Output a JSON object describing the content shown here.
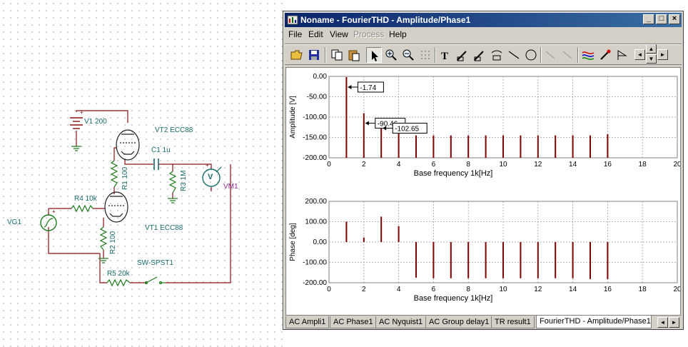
{
  "schematic": {
    "labels": {
      "v1": "V1 200",
      "vt2": "VT2 ECC88",
      "c1": "C1 1u",
      "r1": "R1 100",
      "r3": "R3 1M",
      "vm1": "VM1",
      "vm1_symbol": "V",
      "r4": "R4 10k",
      "vg1": "VG1",
      "vt1": "VT1 ECC88",
      "r2": "R2 100",
      "sw": "SW-SPST1",
      "r5": "R5 20k"
    }
  },
  "window": {
    "title": "Noname - FourierTHD - Amplitude/Phase1",
    "buttons": {
      "minimize": "_",
      "maximize": "□",
      "close": "×"
    },
    "menu": [
      "File",
      "Edit",
      "View",
      "Process",
      "Help"
    ],
    "menu_disabled": "Process",
    "toolbar": {
      "open": "open-folder-icon",
      "save": "save-icon",
      "copy": "copy-icon",
      "paste": "paste-icon",
      "select": "pointer-icon",
      "zoom_in": "zoom-in-icon",
      "zoom_fit": "zoom-100-icon",
      "text": "T",
      "scroll_left": "◄",
      "scroll_right": "►"
    },
    "tabs": [
      "AC Ampli1",
      "AC Phase1",
      "AC Nyquist1",
      "AC Group delay1",
      "TR result1",
      "FourierTHD - Amplitude/Phase1"
    ]
  },
  "chart_data": [
    {
      "type": "bar",
      "title": "",
      "xlabel": "Base frequency 1k[Hz]",
      "ylabel": "Amplitude [V]",
      "xlim": [
        0,
        20
      ],
      "ylim": [
        -200,
        0
      ],
      "xticks": [
        0,
        2,
        4,
        6,
        8,
        10,
        12,
        14,
        16,
        18,
        20
      ],
      "ytick_labels": [
        "0.00",
        "-50.00",
        "-100.00",
        "-150.00",
        "-200.00"
      ],
      "yticks": [
        0,
        -50,
        -100,
        -150,
        -200
      ],
      "x": [
        1,
        2,
        3,
        4,
        5,
        6,
        7,
        8,
        9,
        10,
        11,
        12,
        13,
        14,
        15,
        16
      ],
      "values": [
        -1.74,
        -90.46,
        -102.65,
        -140,
        -145,
        -145,
        -145,
        -145,
        -145,
        -145,
        -145,
        -145,
        -145,
        -145,
        -145,
        -142
      ],
      "annotations": [
        {
          "x": 1,
          "y": -1.74,
          "text": "-1.74"
        },
        {
          "x": 2,
          "y": -90.46,
          "text": "-90.46"
        },
        {
          "x": 3,
          "y": -102.65,
          "text": "-102.65"
        }
      ],
      "grid": true,
      "color": "#800000"
    },
    {
      "type": "bar",
      "title": "",
      "xlabel": "Base frequency 1k[Hz]",
      "ylabel": "Phase [deg]",
      "xlim": [
        0,
        20
      ],
      "ylim": [
        -200,
        200
      ],
      "xticks": [
        0,
        2,
        4,
        6,
        8,
        10,
        12,
        14,
        16,
        18,
        20
      ],
      "ytick_labels": [
        "200.00",
        "100.00",
        "0.00",
        "-100.00",
        "-200.00"
      ],
      "yticks": [
        200,
        100,
        0,
        -100,
        -200
      ],
      "x": [
        1,
        2,
        3,
        4,
        5,
        6,
        7,
        8,
        9,
        10,
        11,
        12,
        13,
        14,
        15,
        16
      ],
      "values": [
        100,
        22,
        125,
        78,
        -175,
        -178,
        -178,
        -178,
        -178,
        -178,
        -178,
        -178,
        -178,
        -178,
        -182,
        -182
      ],
      "grid": true,
      "color": "#800000"
    }
  ]
}
